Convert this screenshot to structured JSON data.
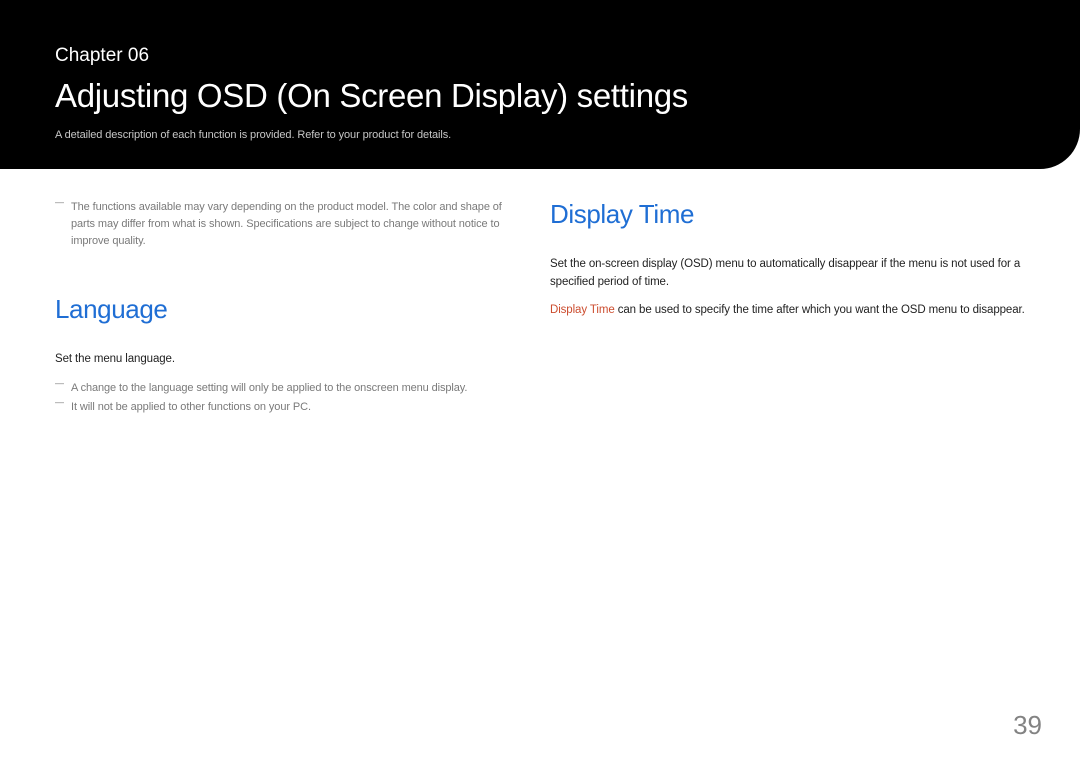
{
  "header": {
    "chapter_label": "Chapter 06",
    "title": "Adjusting OSD (On Screen Display) settings",
    "subtitle": "A detailed description of each function is provided. Refer to your product for details."
  },
  "left": {
    "top_note": "The functions available may vary depending on the product model. The color and shape of parts may differ from what is shown. Specifications are subject to change without notice to improve quality.",
    "heading": "Language",
    "body": "Set the menu language.",
    "note1": "A change to the language setting will only be applied to the onscreen menu display.",
    "note2": "It will not be applied to other functions on your PC."
  },
  "right": {
    "heading": "Display Time",
    "body1": "Set the on-screen display (OSD) menu to automatically disappear if the menu is not used for a specified period of time.",
    "emphasis": "Display Time",
    "body2_rest": " can be used to specify the time after which you want the OSD menu to disappear."
  },
  "page_number": "39"
}
